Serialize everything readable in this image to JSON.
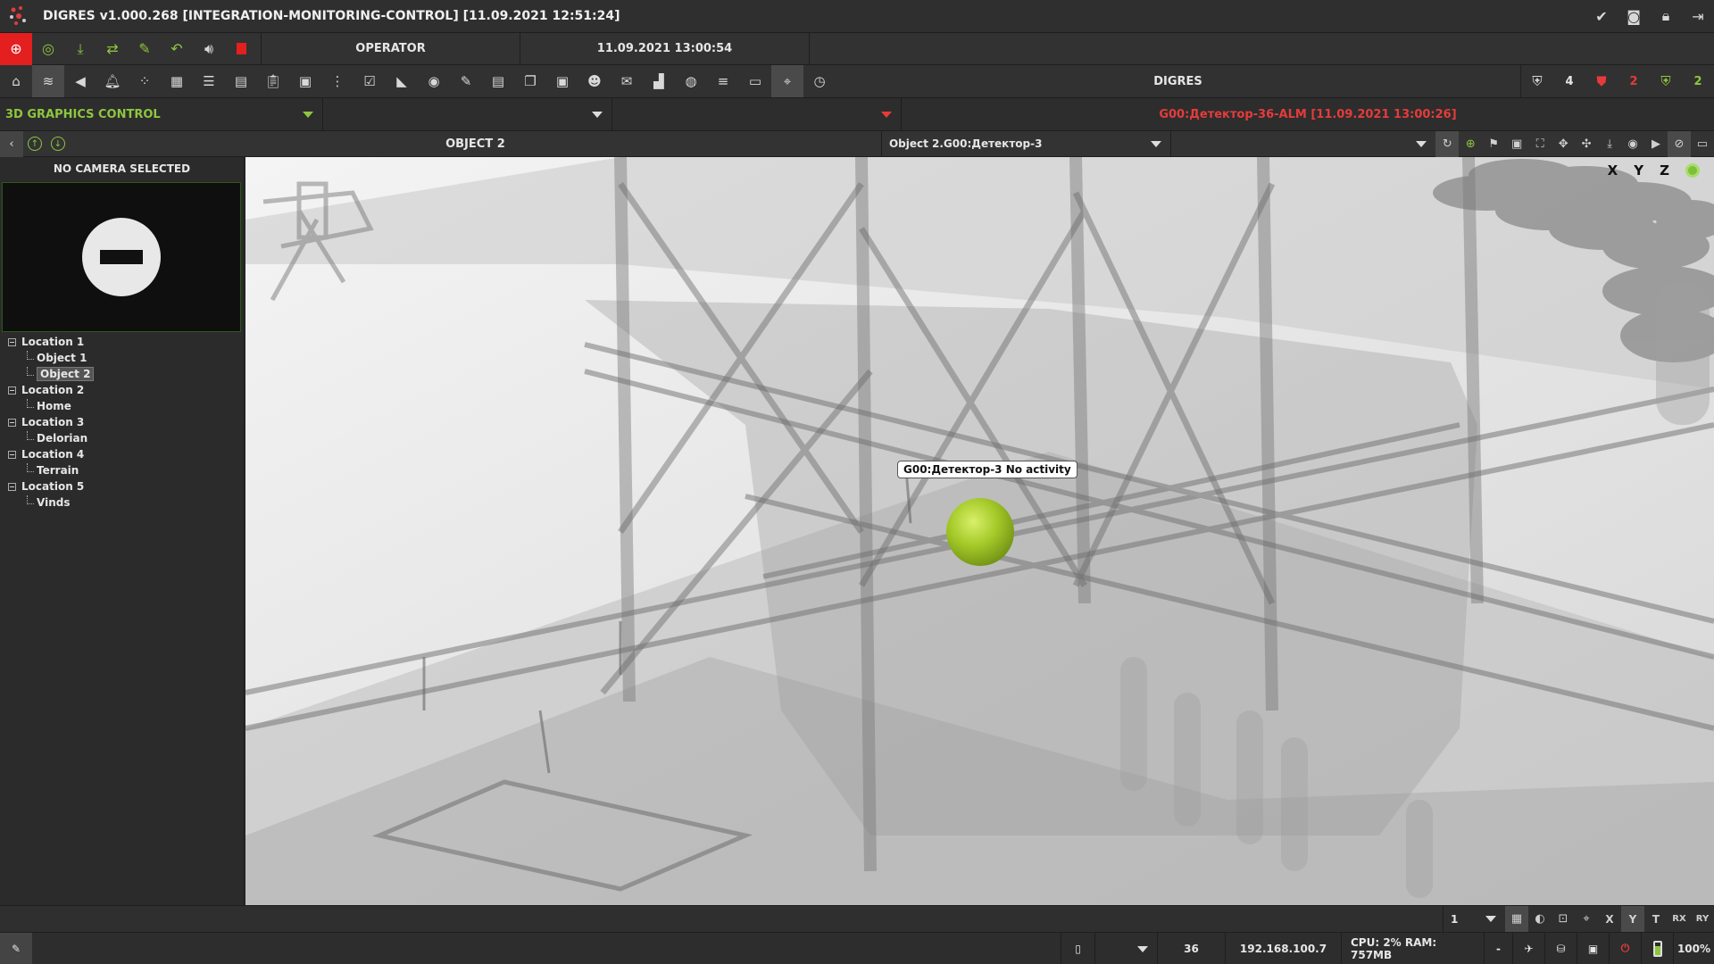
{
  "window": {
    "title": "DIGRES v1.000.268 [INTEGRATION-MONITORING-CONTROL] [11.09.2021 12:51:24]"
  },
  "top": {
    "role": "OPERATOR",
    "datetime": "11.09.2021 13:00:54"
  },
  "toolbar": {
    "center_label": "DIGRES",
    "count_total": "4",
    "count_alarm": "2",
    "count_ok": "2"
  },
  "selectors": {
    "module": "3D GRAPHICS CONTROL",
    "second": "",
    "third": "",
    "alarm_message": "G00:Детектор-36-ALM [11.09.2021 13:00:26]"
  },
  "nav": {
    "object_title": "OBJECT 2",
    "detector_select": "Object 2.G00:Детектор-3",
    "view_select": ""
  },
  "camera": {
    "status": "NO CAMERA SELECTED"
  },
  "tree": [
    {
      "label": "Location 1",
      "children": [
        "Object 1",
        "Object 2"
      ]
    },
    {
      "label": "Location 2",
      "children": [
        "Home"
      ]
    },
    {
      "label": "Location 3",
      "children": [
        "Delorian"
      ]
    },
    {
      "label": "Location 4",
      "children": [
        "Terrain"
      ]
    },
    {
      "label": "Location 5",
      "children": [
        "Vinds"
      ]
    }
  ],
  "viewport": {
    "axis_x": "X",
    "axis_y": "Y",
    "axis_z": "Z",
    "sensor_label": "G00:Детектор-3 No activity"
  },
  "bottom_toolbar": {
    "page_select": "1",
    "btn_x": "X",
    "btn_y": "Y",
    "btn_t": "T",
    "btn_rx": "RX",
    "btn_ry": "RY"
  },
  "status": {
    "count": "36",
    "ip": "192.168.100.7",
    "resources": "CPU: 2% RAM: 757MB",
    "dash": "-",
    "zoom": "100%"
  },
  "colors": {
    "accent_green": "#8ec63f",
    "alarm_red": "#e63b3b",
    "stop_red": "#e41f1f"
  }
}
